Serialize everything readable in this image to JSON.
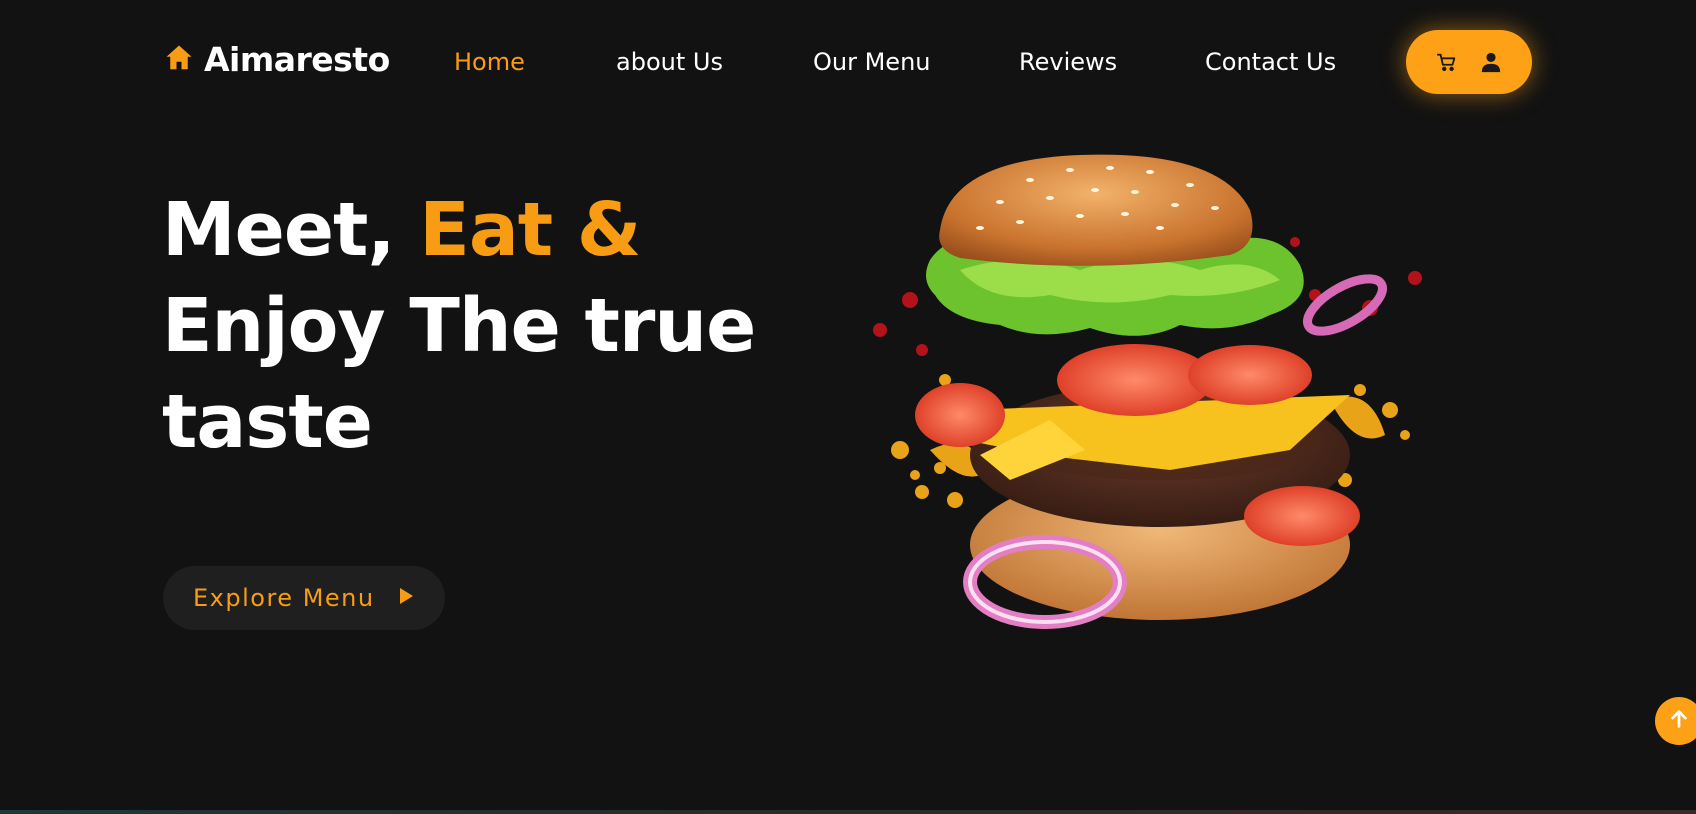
{
  "colors": {
    "accent": "#f89d13",
    "accent_button": "#fea116",
    "background": "#121212",
    "button_bg": "#1f1f1f"
  },
  "brand": {
    "name": "Aimaresto",
    "icon": "home-icon"
  },
  "nav": {
    "links": [
      {
        "label": "Home",
        "active": true
      },
      {
        "label": "about Us",
        "active": false
      },
      {
        "label": "Our Menu",
        "active": false
      },
      {
        "label": "Reviews",
        "active": false
      },
      {
        "label": "Contact Us",
        "active": false
      }
    ],
    "actions": [
      {
        "icon": "cart-icon"
      },
      {
        "icon": "user-icon"
      }
    ]
  },
  "hero": {
    "line1_white": "Meet, ",
    "line1_accent": "Eat &",
    "line2": "Enjoy The true",
    "line3": "taste",
    "button_label": "Explore Menu",
    "button_icon": "play-icon",
    "image": "burger-image"
  },
  "scroll_top": {
    "icon": "arrow-up-icon"
  }
}
